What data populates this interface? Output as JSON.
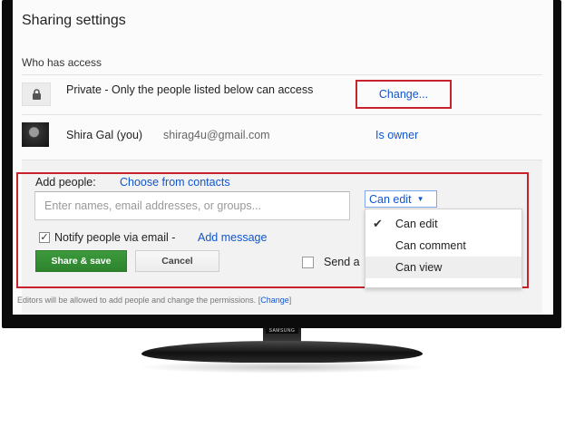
{
  "dialog": {
    "title": "Sharing settings",
    "section_label": "Who has access"
  },
  "access": {
    "privacy_text": "Private - Only the people listed below can access",
    "change_link": "Change...",
    "owner": {
      "name": "Shira Gal (you)",
      "email": "shirag4u@gmail.com",
      "role": "Is owner"
    }
  },
  "add_people": {
    "label": "Add people:",
    "choose_link": "Choose from contacts",
    "input_placeholder": "Enter names, email addresses, or groups...",
    "permission_selected": "Can edit",
    "permission_options": [
      "Can edit",
      "Can comment",
      "Can view"
    ],
    "notify_checked": true,
    "notify_label": "Notify people via email -",
    "add_message_link": "Add message",
    "share_button": "Share & save",
    "cancel_button": "Cancel",
    "send_copy_label": "Send a"
  },
  "footer": {
    "note": "Editors will be allowed to add people and change the permissions.",
    "open_bracket": "[",
    "change_link": "Change",
    "close_bracket": "]"
  },
  "tv": {
    "brand": "SAMSUNG"
  },
  "colors": {
    "link": "#1155cc",
    "highlight_box": "#c8232c",
    "share_button": "#2d842d"
  }
}
